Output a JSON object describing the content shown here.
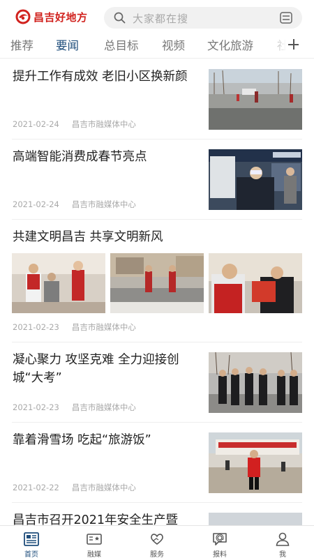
{
  "header": {
    "app_name": "昌吉好地方",
    "search_placeholder": "大家都在搜",
    "brand_color": "#d1221e"
  },
  "tabs": [
    {
      "label": "推荐",
      "active": false
    },
    {
      "label": "要闻",
      "active": true
    },
    {
      "label": "总目标",
      "active": false
    },
    {
      "label": "视频",
      "active": false
    },
    {
      "label": "文化旅游",
      "active": false
    },
    {
      "label": "社",
      "active": false
    }
  ],
  "accent_color": "#1e4d7b",
  "articles": [
    {
      "title": "提升工作有成效 老旧小区换新颜",
      "date": "2021-02-24",
      "source": "昌吉市融媒体中心"
    },
    {
      "title": "高端智能消费成春节亮点",
      "date": "2021-02-24",
      "source": "昌吉市融媒体中心"
    },
    {
      "title": "共建文明昌吉 共享文明新风",
      "date": "2021-02-23",
      "source": "昌吉市融媒体中心"
    },
    {
      "title": "凝心聚力 攻坚克难 全力迎接创城“大考”",
      "date": "2021-02-23",
      "source": "昌吉市融媒体中心"
    },
    {
      "title": "靠着滑雪场 吃起“旅游饭”",
      "date": "2021-02-22",
      "source": "昌吉市融媒体中心"
    },
    {
      "title": "昌吉市召开2021年安全生产暨",
      "date": "",
      "source": ""
    }
  ],
  "bottom_nav": [
    {
      "label": "首页",
      "icon": "newspaper-icon",
      "active": true
    },
    {
      "label": "融媒",
      "icon": "media-icon",
      "active": false
    },
    {
      "label": "服务",
      "icon": "heart-hands-icon",
      "active": false
    },
    {
      "label": "报料",
      "icon": "report-chat-icon",
      "active": false
    },
    {
      "label": "我",
      "icon": "user-icon",
      "active": false
    }
  ]
}
